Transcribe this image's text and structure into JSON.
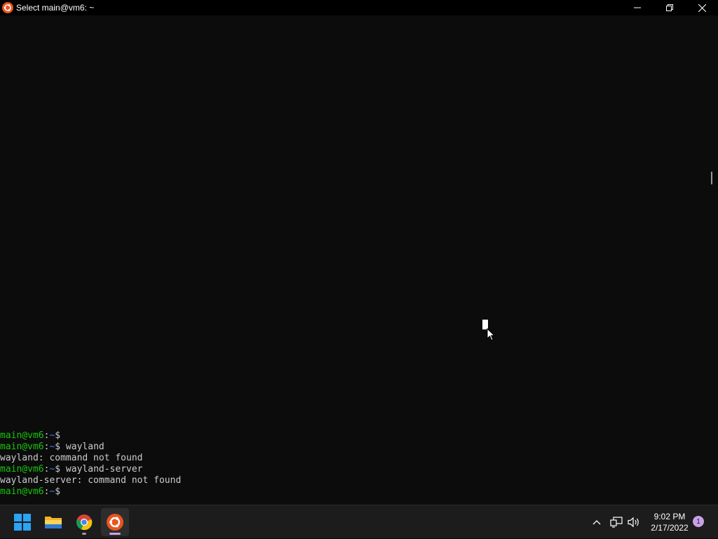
{
  "window": {
    "title": "Select main@vm6: ~",
    "app_icon": "ubuntu-icon",
    "controls": [
      "minimize-icon",
      "restore-icon",
      "close-icon"
    ]
  },
  "terminal": {
    "prompt_user": "main@vm6",
    "prompt_path": "~",
    "lines": [
      {
        "type": "prompt",
        "user": "main@vm6",
        "sep": ":",
        "path": "~",
        "cmd": "$"
      },
      {
        "type": "prompt",
        "user": "main@vm6",
        "sep": ":",
        "path": "~",
        "cmd": "$ wayland"
      },
      {
        "type": "output",
        "text": "wayland: command not found"
      },
      {
        "type": "prompt",
        "user": "main@vm6",
        "sep": ":",
        "path": "~",
        "cmd": "$ wayland-server"
      },
      {
        "type": "output",
        "text": "wayland-server: command not found"
      },
      {
        "type": "prompt",
        "user": "main@vm6",
        "sep": ":",
        "path": "~",
        "cmd": "$"
      }
    ],
    "colors": {
      "background": "#0c0c0c",
      "user": "#16c60c",
      "path": "#3b78ff",
      "text": "#cccccc"
    }
  },
  "taskbar": {
    "apps": [
      {
        "name": "windows-start",
        "icon": "windows-logo-icon"
      },
      {
        "name": "file-explorer",
        "icon": "folder-icon"
      },
      {
        "name": "chrome",
        "icon": "chrome-icon"
      },
      {
        "name": "ubuntu",
        "icon": "ubuntu-icon",
        "active": true
      }
    ],
    "tray_icons": [
      "chevron-up-icon",
      "network-icon",
      "volume-icon"
    ],
    "clock": {
      "time": "9:02 PM",
      "date": "2/17/2022"
    },
    "notification_count": "1"
  }
}
